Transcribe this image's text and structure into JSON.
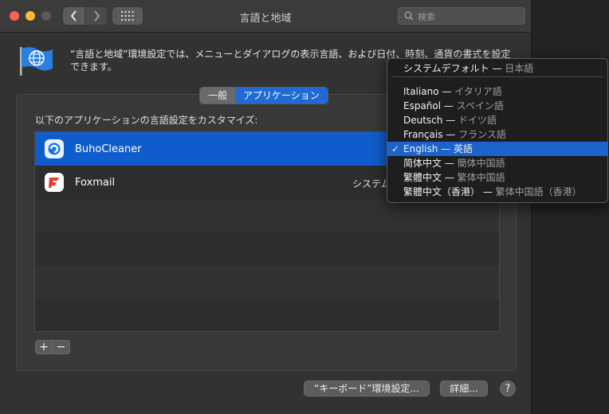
{
  "window": {
    "title": "言語と地域"
  },
  "search": {
    "placeholder": "検索"
  },
  "description": "“言語と地域”環境設定では、メニューとダイアログの表示言語、および日付、時刻、通貨の書式を設定できます。",
  "tabs": {
    "general": "一般",
    "apps": "アプリケーション"
  },
  "list": {
    "label": "以下のアプリケーションの言語設定をカスタマイズ:",
    "apps": [
      {
        "name": "BuhoCleaner",
        "language": ""
      },
      {
        "name": "Foxmail",
        "language": "システムデフォルト"
      }
    ]
  },
  "controls": {
    "add": "+",
    "remove": "−"
  },
  "buttons": {
    "keyboard": "“キーボード”環境設定...",
    "advanced": "詳細...",
    "help": "?"
  },
  "menu": {
    "default": {
      "primary": "システムデフォルト",
      "sep": " — ",
      "secondary": "日本語"
    },
    "items": [
      {
        "primary": "Italiano",
        "secondary": "イタリア語"
      },
      {
        "primary": "Español",
        "secondary": "スペイン語"
      },
      {
        "primary": "Deutsch",
        "secondary": "ドイツ語"
      },
      {
        "primary": "Français",
        "secondary": "フランス語"
      },
      {
        "primary": "English",
        "secondary": "英語",
        "checkmark": "✓"
      },
      {
        "primary": "简体中文",
        "secondary": "簡体中国語"
      },
      {
        "primary": "繁體中文",
        "secondary": "繁体中国語"
      },
      {
        "primary": "繁體中文（香港）",
        "secondary": "繁体中国語（香港）"
      }
    ],
    "dash": " — "
  },
  "colors": {
    "accent": "#1c63cc",
    "selected_row": "#0f5ccd"
  },
  "icons": {
    "flag": "globe-flag-icon",
    "buhocleaner": "buhocleaner-app-icon",
    "foxmail": "foxmail-app-icon"
  }
}
